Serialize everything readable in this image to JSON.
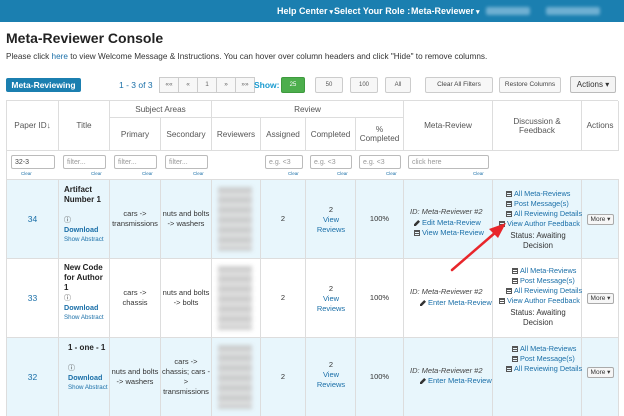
{
  "topbar": {
    "help_center": "Help Center",
    "select_role_label": "Select Your Role :",
    "role": "Meta-Reviewer"
  },
  "page": {
    "title": "Meta-Reviewer Console",
    "instr_pre": "Please click",
    "instr_link": "here",
    "instr_post": "to view Welcome Message & Instructions. You can hover over column headers and click \"Hide\" to remove columns."
  },
  "toolbar": {
    "badge": "Meta-Reviewing",
    "pages_info": "1 - 3 of 3",
    "pager": [
      "««",
      "«",
      "1",
      "»",
      "»»"
    ],
    "show_label": "Show:",
    "sizes": [
      "25",
      "50",
      "100",
      "All"
    ],
    "active_size": "25",
    "clear_filters": "Clear All Filters",
    "restore_columns": "Restore Columns",
    "actions": "Actions"
  },
  "table": {
    "group_headers": {
      "subject_areas": "Subject Areas",
      "review": "Review"
    },
    "headers": {
      "paper_id": "Paper ID",
      "title": "Title",
      "primary": "Primary",
      "secondary": "Secondary",
      "reviewers": "Reviewers",
      "assigned": "Assigned",
      "completed": "Completed",
      "pct_completed": "% Completed",
      "meta_review": "Meta-Review",
      "discussion": "Discussion & Feedback",
      "actions": "Actions"
    },
    "filters": {
      "paper_id": "32-3",
      "title": "filter...",
      "primary": "filter...",
      "secondary": "filter...",
      "assigned": "e.g. <3",
      "completed": "e.g. <3",
      "pct": "e.g. <3",
      "meta": "click here",
      "clear": "Clear"
    },
    "rows": [
      {
        "id": "34",
        "title": "Artifact Number 1",
        "download": "Download",
        "abstract": "Show Abstract",
        "primary": "cars -> transmissions",
        "secondary": "nuts and bolts -> washers",
        "assigned": "2",
        "completed_count": "2",
        "completed_link": "View Reviews",
        "pct": "100%",
        "meta_id": "ID: Meta-Reviewer #2",
        "meta_links": [
          "Edit Meta-Review",
          "View Meta-Review"
        ],
        "disc_links": [
          "All Meta-Reviews",
          "Post Message(s)",
          "All Reviewing Details",
          "View Author Feedback"
        ],
        "status": "Status: Awaiting Decision",
        "more": "More"
      },
      {
        "id": "33",
        "title": "New Code for Author 1",
        "download": "Download",
        "abstract": "Show Abstract",
        "primary": "cars -> chassis",
        "secondary": "nuts and bolts -> bolts",
        "assigned": "2",
        "completed_count": "2",
        "completed_link": "View Reviews",
        "pct": "100%",
        "meta_id": "ID: Meta-Reviewer #2",
        "meta_links": [
          "Enter Meta-Review"
        ],
        "disc_links": [
          "All Meta-Reviews",
          "Post Message(s)",
          "All Reviewing Details",
          "View Author Feedback"
        ],
        "status": "Status: Awaiting Decision",
        "more": "More"
      },
      {
        "id": "32",
        "title": "1 - one - 1",
        "download": "Download",
        "abstract": "Show Abstract",
        "primary": "nuts and bolts -> washers",
        "secondary": "cars -> chassis; cars -> transmissions",
        "assigned": "2",
        "completed_count": "2",
        "completed_link": "View Reviews",
        "pct": "100%",
        "meta_id": "ID: Meta-Reviewer #2",
        "meta_links": [
          "Enter Meta-Review"
        ],
        "disc_links": [
          "All Meta-Reviews",
          "Post Message(s)",
          "All Reviewing Details"
        ],
        "status": "",
        "more": "More"
      }
    ]
  },
  "colors": {
    "brand": "#1b7fb0",
    "link": "#1a6fa8",
    "active_green": "#4cae4c",
    "row_highlight": "#e8f6fc",
    "annotation_arrow": "#e8262b"
  }
}
